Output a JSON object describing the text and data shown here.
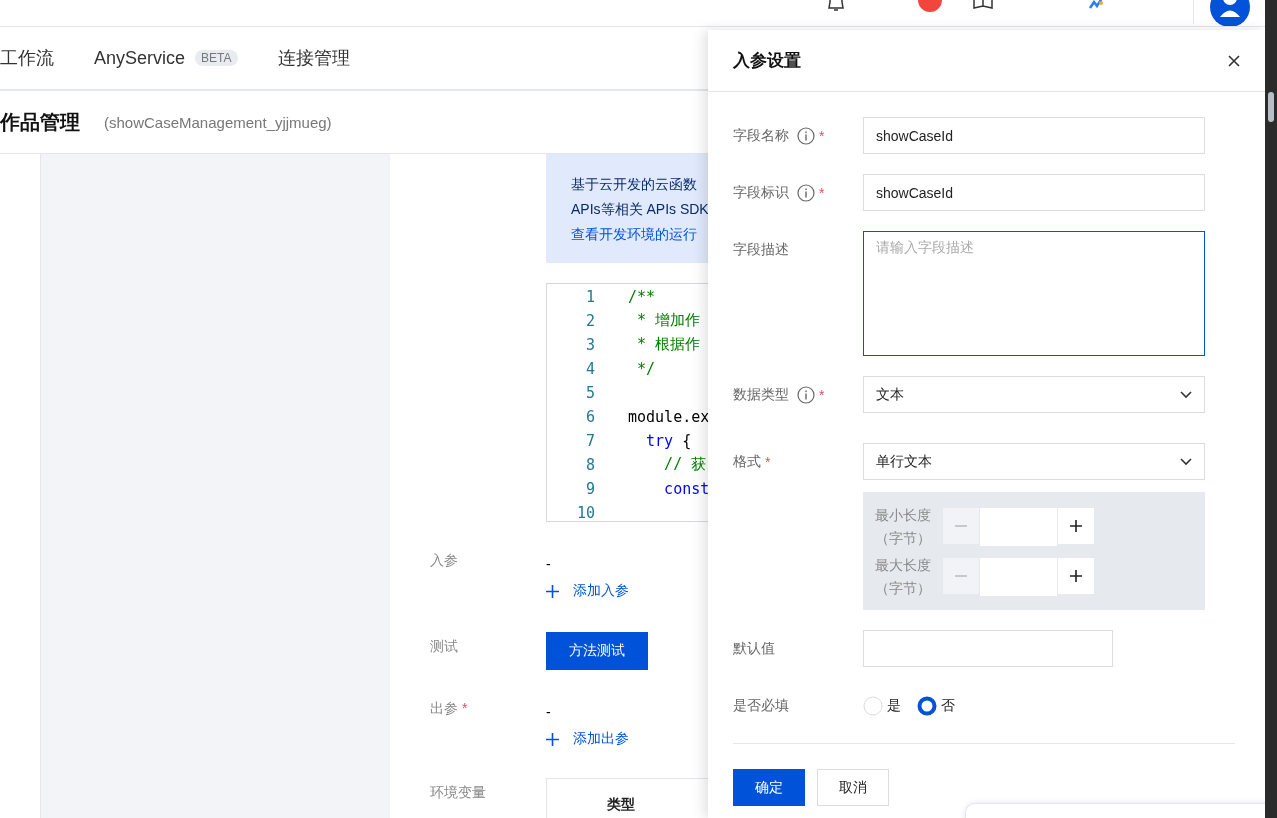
{
  "nav": {
    "tabs": [
      {
        "label": "工作流",
        "selected": false
      },
      {
        "label": "AnyService",
        "badge": "BETA",
        "selected": false
      },
      {
        "label": "连接管理",
        "selected": false
      }
    ]
  },
  "page": {
    "title": "作品管理",
    "identifier": "(showCaseManagement_yjjmueg)"
  },
  "notice": {
    "lines": [
      "基于云开发的云函数",
      "APIs等相关 APIs SDK"
    ],
    "link": "查看开发环境的运行"
  },
  "code_editor": {
    "lines": [
      {
        "number": "1",
        "parts": [
          {
            "text": "/**",
            "kind": "comment"
          }
        ]
      },
      {
        "number": "2",
        "parts": [
          {
            "text": " * 增加作",
            "kind": "comment"
          }
        ]
      },
      {
        "number": "3",
        "parts": [
          {
            "text": " * 根据作",
            "kind": "comment"
          }
        ]
      },
      {
        "number": "4",
        "parts": [
          {
            "text": " */",
            "kind": "comment"
          }
        ]
      },
      {
        "number": "5"
      },
      {
        "number": "6",
        "parts": [
          {
            "text": "module.ex",
            "kind": "plain"
          }
        ]
      },
      {
        "number": "7",
        "parts": [
          {
            "text": "  try",
            "kind": "keyword"
          },
          {
            "text": " {",
            "kind": "plain"
          }
        ]
      },
      {
        "number": "8",
        "parts": [
          {
            "text": "    // 获",
            "kind": "comment"
          }
        ]
      },
      {
        "number": "9",
        "parts": [
          {
            "text": "    const",
            "kind": "keyword"
          }
        ]
      },
      {
        "number": "10"
      }
    ]
  },
  "method_form": {
    "rows": [
      {
        "label": "入参",
        "kind": "param",
        "value": "-",
        "action": "添加入参"
      },
      {
        "label": "测试",
        "kind": "button",
        "button": "方法测试"
      },
      {
        "label": "出参",
        "required_mark": "*",
        "kind": "param",
        "value": "-",
        "action": "添加出参"
      },
      {
        "label": "环境变量",
        "kind": "table",
        "columns": [
          "类型"
        ]
      }
    ]
  },
  "drawer": {
    "title": "入参设置",
    "fields": [
      {
        "label": "字段名称",
        "info": true,
        "required_mark": "*",
        "kind": "input",
        "value": "showCaseId",
        "focused": false
      },
      {
        "label": "字段标识",
        "info": true,
        "required_mark": "*",
        "kind": "input",
        "value": "showCaseId",
        "focused": false
      },
      {
        "label": "字段描述",
        "info": false,
        "kind": "textarea",
        "placeholder": "请输入字段描述",
        "focused": true
      },
      {
        "label": "数据类型",
        "info": true,
        "required_mark": "*",
        "kind": "select",
        "value": "文本",
        "focused": false
      },
      {
        "label": "格式",
        "info": false,
        "required_mark": "*",
        "kind": "select",
        "value": "单行文本",
        "focused": false
      },
      {
        "kind": "limits",
        "limits": [
          {
            "label": "最小长度（字节）"
          },
          {
            "label": "最大长度（字节）"
          }
        ]
      },
      {
        "label": "默认值",
        "info": false,
        "kind": "short_input",
        "focused": false
      },
      {
        "label": "是否必填",
        "info": false,
        "kind": "radio",
        "options": [
          {
            "label": "是",
            "selected": false
          },
          {
            "label": "否",
            "selected": true
          }
        ]
      }
    ],
    "buttons": [
      {
        "label": "确定",
        "primary": true
      },
      {
        "label": "取消",
        "primary": false
      }
    ]
  }
}
